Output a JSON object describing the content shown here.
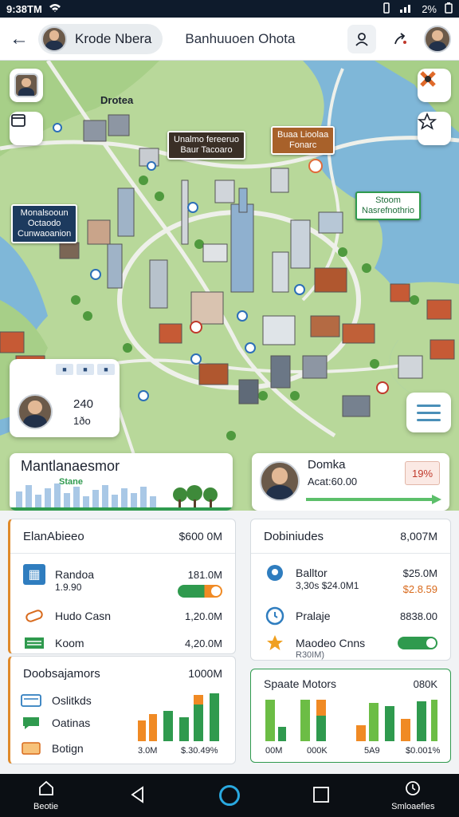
{
  "status_bar": {
    "time": "9:38TM",
    "battery": "2%"
  },
  "header": {
    "user_name": "Krode Nbera",
    "title": "Banhuuoen Ohota"
  },
  "map": {
    "label_main": "Drotea",
    "callouts": [
      {
        "text": "Unalmo fereeruo\nBaur Tacoaro",
        "style": "dark"
      },
      {
        "text": "Buaa Lioolaa\nFonarc",
        "style": "brown"
      },
      {
        "text": "Monalsooun\nOctaodo\nCunwaoanion",
        "style": "navy"
      },
      {
        "text": "Stoom\nNasrefnothrio",
        "style": "green"
      }
    ],
    "person_card": {
      "value_1": "240",
      "value_2": "1ðo"
    }
  },
  "overlay_left": {
    "title": "Mantlanaesmor",
    "subtitle": "Stane"
  },
  "overlay_right": {
    "name": "Domka",
    "line": "Acat:60.00",
    "badge": "19%"
  },
  "cards": {
    "top_left": {
      "title": "ElanAbieeo",
      "amount": "$600 0M",
      "items": [
        {
          "icon": "barcode-icon",
          "label": "Randoa",
          "sub": "1.9.90",
          "amount": "181.0M",
          "control": "toggle-orange"
        },
        {
          "icon": "pill-icon",
          "label": "Hudo Casn",
          "amount": "1,20.0M"
        },
        {
          "icon": "cash-icon",
          "label": "Koom",
          "amount": "4,20.0M"
        }
      ]
    },
    "top_right": {
      "title": "Dobiniudes",
      "amount": "8,007M",
      "items": [
        {
          "icon": "location-icon",
          "label": "Balltor",
          "sub": "3,30s $24.0M1",
          "amount": "$25.0M",
          "amount2": "$2.8.59"
        },
        {
          "icon": "clock-icon",
          "label": "Pralaje",
          "amount": "8838.00"
        },
        {
          "icon": "star-icon",
          "label": "Maodeo Cnns",
          "sub": "R30IM)",
          "control": "toggle-green"
        }
      ]
    },
    "bottom_left": {
      "title": "Doobsajamors",
      "amount": "1000M",
      "items": [
        {
          "icon": "card-icon",
          "label": "Oslitkds"
        },
        {
          "icon": "chat-icon",
          "label": "Oatinas"
        },
        {
          "icon": "ticket-icon",
          "label": "Botign"
        }
      ],
      "axis_labels": [
        "3.0M",
        "$.30.49%"
      ]
    },
    "bottom_right": {
      "title": "Spaate Motors",
      "amount": "080K",
      "axis_labels": [
        "00M",
        "000K",
        "5A9",
        "$0.001%"
      ]
    }
  },
  "navbar": {
    "items": [
      {
        "label": "Beotie",
        "icon": "home-icon"
      },
      {
        "label": "",
        "icon": "back-triangle-icon"
      },
      {
        "label": "",
        "icon": "home-ring-icon"
      },
      {
        "label": "",
        "icon": "recents-square-icon"
      },
      {
        "label": "Smloaefies",
        "icon": "clock-icon"
      }
    ]
  },
  "colors": {
    "accent_green": "#2f9a4e",
    "accent_orange": "#f08a24",
    "map_water": "#7fb7d8",
    "map_land": "#b8d89a"
  }
}
